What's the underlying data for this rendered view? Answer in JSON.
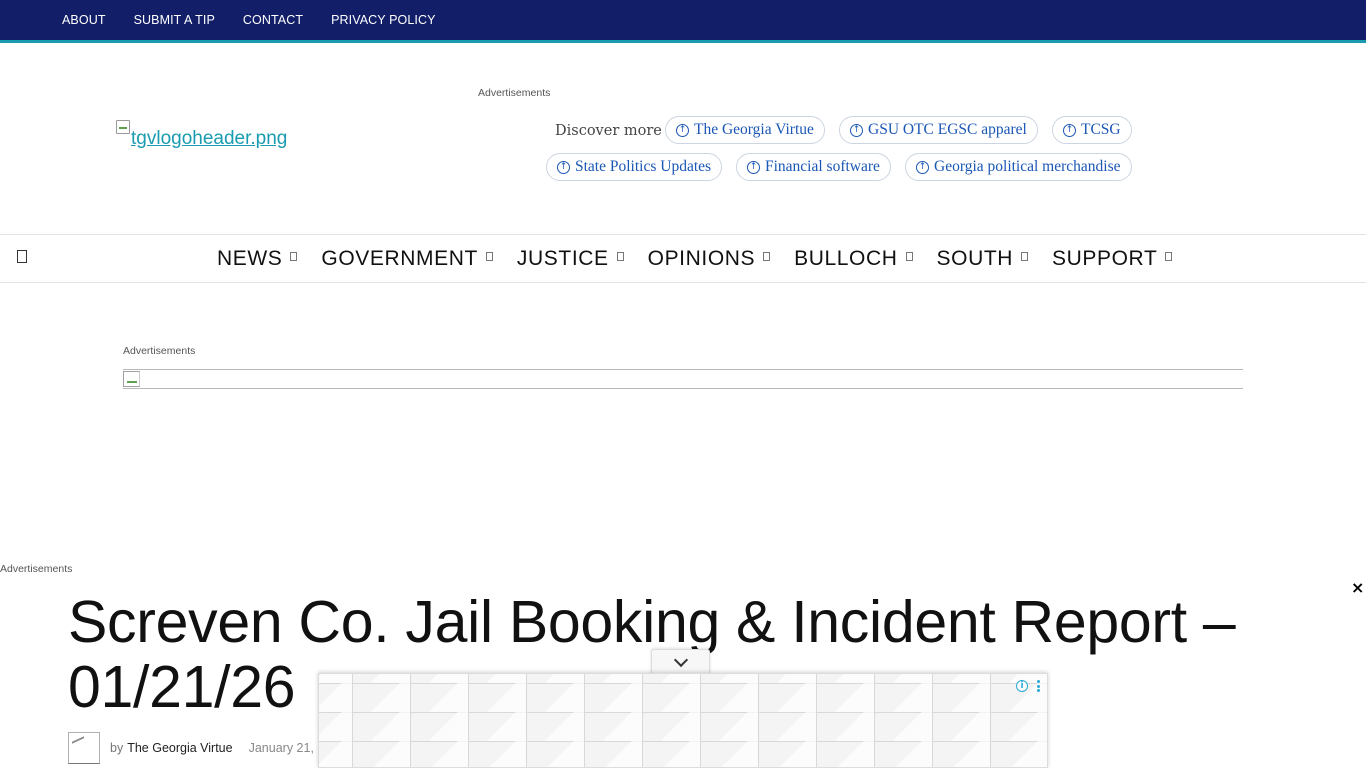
{
  "topbar": {
    "links": [
      {
        "label": "ABOUT"
      },
      {
        "label": "SUBMIT A TIP"
      },
      {
        "label": "CONTACT"
      },
      {
        "label": "PRIVACY POLICY"
      }
    ]
  },
  "header": {
    "ad_label": "Advertisements",
    "logo_alt": "tgvlogoheader.png",
    "discover": {
      "label": "Discover more",
      "pills": [
        {
          "label": "The Georgia Virtue"
        },
        {
          "label": "GSU OTC EGSC apparel"
        },
        {
          "label": "TCSG"
        },
        {
          "label": "State Politics Updates"
        },
        {
          "label": "Financial software"
        },
        {
          "label": "Georgia political merchandise"
        }
      ]
    }
  },
  "nav": {
    "items": [
      {
        "label": "NEWS"
      },
      {
        "label": "GOVERNMENT"
      },
      {
        "label": "JUSTICE"
      },
      {
        "label": "OPINIONS"
      },
      {
        "label": "BULLOCH"
      },
      {
        "label": "SOUTH"
      },
      {
        "label": "SUPPORT"
      }
    ]
  },
  "ads": {
    "banner_label": "Advertisements",
    "left_label": "Advertisements",
    "close_glyph": "×",
    "info_glyph": "i"
  },
  "article": {
    "title": "Screven Co. Jail Booking & Incident Report – 01/21/26",
    "by_prefix": "by",
    "author": "The Georgia Virtue",
    "date": "January 21,"
  },
  "colors": {
    "topbar_bg": "#121f68",
    "accent": "#1a9bb0",
    "pill_text": "#1b57b5"
  }
}
